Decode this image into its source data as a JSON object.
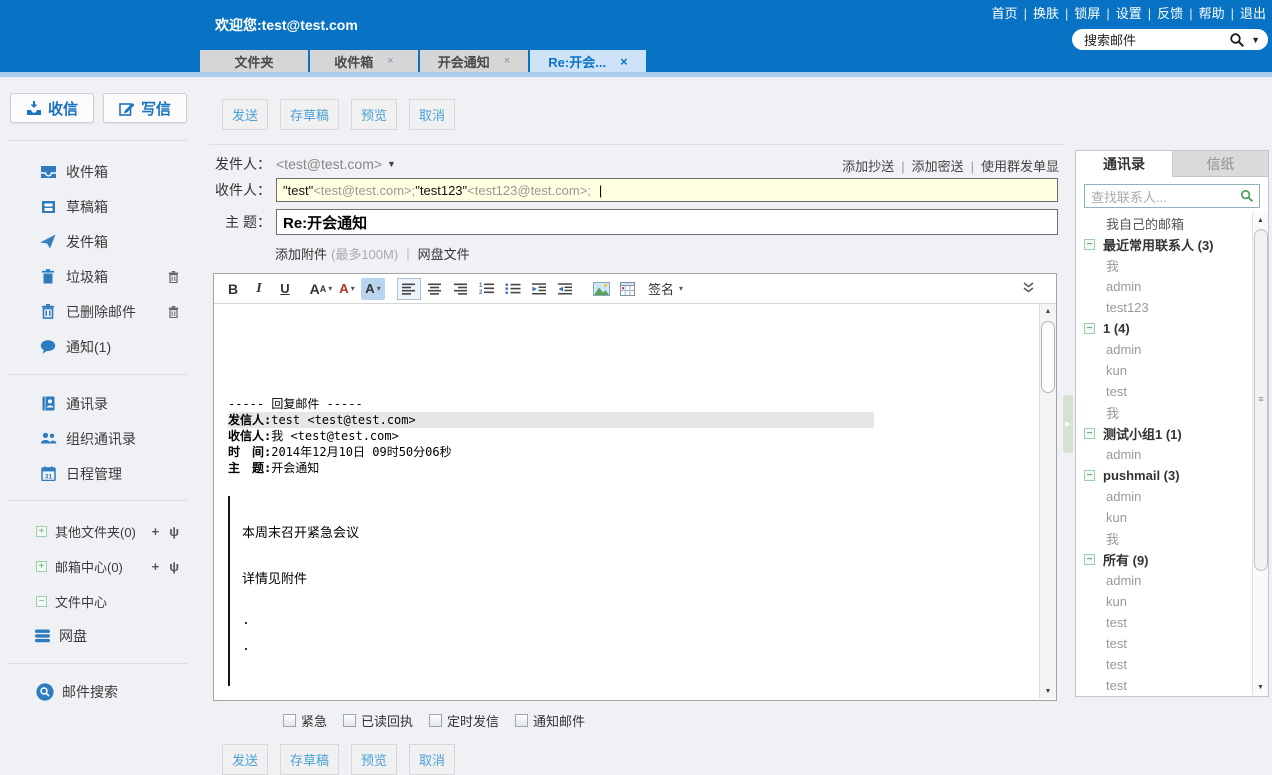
{
  "icons": {
    "close": "×",
    "caret": "▼",
    "small_caret": "▾",
    "plus": "+",
    "pin": "ψ",
    "minus": "−",
    "up": "▲",
    "down": "▼",
    "grip": "≡",
    "arrow_right": "▶",
    "cursor": "|"
  },
  "header": {
    "nav": [
      "首页",
      "换肤",
      "锁屏",
      "设置",
      "反馈",
      "帮助",
      "退出"
    ],
    "welcome": "欢迎您:test@test.com",
    "search_text": "搜索邮件",
    "tabs": [
      {
        "label": "文件夹"
      },
      {
        "label": "收件箱"
      },
      {
        "label": "开会通知"
      },
      {
        "label": "Re:开会..."
      }
    ]
  },
  "sidebar": {
    "receive": "收信",
    "compose": "写信",
    "folders": [
      "收件箱",
      "草稿箱",
      "发件箱",
      "垃圾箱",
      "已删除邮件",
      "通知(1)"
    ],
    "tools": [
      "通讯录",
      "组织通讯录",
      "日程管理"
    ],
    "extra": [
      "其他文件夹(0)",
      "邮箱中心(0)",
      "文件中心",
      "网盘"
    ],
    "search": "邮件搜索"
  },
  "compose": {
    "top_actions": [
      "发送",
      "存草稿",
      "预览",
      "取消"
    ],
    "bottom_actions": [
      "发送",
      "存草稿",
      "预览",
      "取消"
    ],
    "from_label": "发件人：",
    "from_value": "<test@test.com>",
    "header_links": [
      "添加抄送",
      "添加密送",
      "使用群发单显"
    ],
    "to_label": "收件人：",
    "to_name1": "\"test\"",
    "to_email1": " <test@test.com>; ",
    "to_name2": "\"test123\"",
    "to_email2": " <test123@test.com>; ",
    "subject_label": "主 题：",
    "subject_value": "Re:开会通知",
    "attach": "添加附件",
    "attach_limit": "(最多100M)",
    "netdisk": "网盘文件",
    "signature": "签名",
    "quote_title": "----- 回复邮件 -----",
    "q1_label": "发信人:",
    "q1_value": "test <test@test.com>",
    "q2_label": "收信人:",
    "q2_value": "我 <test@test.com>",
    "q3_label": "时　间:",
    "q3_value": "2014年12月10日 09时50分06秒",
    "q4_label": "主　题:",
    "q4_value": "开会通知",
    "body_line1": "本周末召开紧急会议",
    "body_line2": "详情见附件",
    "dot": ".",
    "options": [
      "紧急",
      "已读回执",
      "定时发信",
      "通知邮件"
    ]
  },
  "contacts": {
    "tab_contacts": "通讯录",
    "tab_stationery": "信纸",
    "search_placeholder": "查找联系人...",
    "items": [
      {
        "t": "root",
        "label": "我自己的邮箱"
      },
      {
        "t": "g",
        "label": "最近常用联系人 (3)"
      },
      {
        "t": "m",
        "label": "我"
      },
      {
        "t": "m",
        "label": "admin"
      },
      {
        "t": "m",
        "label": "test123"
      },
      {
        "t": "g",
        "label": "1 (4)"
      },
      {
        "t": "m",
        "label": "admin"
      },
      {
        "t": "m",
        "label": "kun"
      },
      {
        "t": "m",
        "label": "test"
      },
      {
        "t": "m",
        "label": "我"
      },
      {
        "t": "g",
        "label": "测试小组1 (1)"
      },
      {
        "t": "m",
        "label": "admin"
      },
      {
        "t": "g",
        "label": "pushmail (3)"
      },
      {
        "t": "m",
        "label": "admin"
      },
      {
        "t": "m",
        "label": "kun"
      },
      {
        "t": "m",
        "label": "我"
      },
      {
        "t": "g",
        "label": "所有 (9)"
      },
      {
        "t": "m",
        "label": "admin"
      },
      {
        "t": "m",
        "label": "kun"
      },
      {
        "t": "m",
        "label": "test"
      },
      {
        "t": "m",
        "label": "test"
      },
      {
        "t": "m",
        "label": "test"
      },
      {
        "t": "m",
        "label": "test"
      }
    ]
  }
}
